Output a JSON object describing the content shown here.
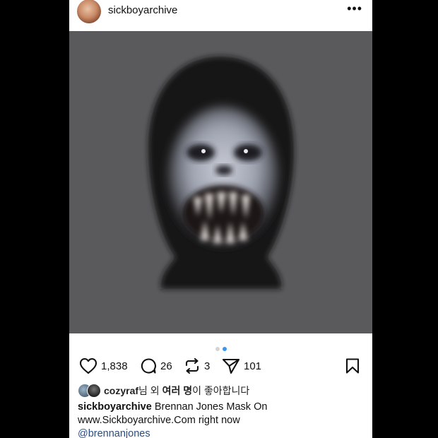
{
  "post": {
    "username": "sickboyarchive"
  },
  "header": {
    "more_label": "•••"
  },
  "carousel": {
    "dot_count": 2,
    "active_index": 1
  },
  "actions": {
    "likes": "1,838",
    "comments": "26",
    "reposts": "3",
    "shares": "101"
  },
  "liked_by": {
    "user": "cozyraf",
    "suffix_1": "님 외 ",
    "bold_part": "여러 명",
    "suffix_2": "이 좋아합니다"
  },
  "caption": {
    "user": "sickboyarchive",
    "text_line1": " Brennan Jones Mask On",
    "text_line2": "www.Sickboyarchive.Com right now",
    "mention": "@brennanjones"
  },
  "colors": {
    "accent_dot": "#3897f0",
    "photo_bg": "#5a5a5d",
    "mention": "#2a4c80"
  }
}
